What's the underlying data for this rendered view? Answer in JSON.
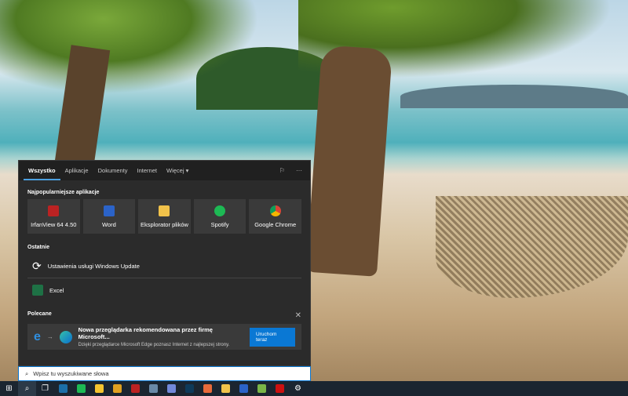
{
  "tabs": [
    "Wszystko",
    "Aplikacje",
    "Dokumenty",
    "Internet",
    "Więcej"
  ],
  "sections": {
    "top": "Najpopularniejsze aplikacje",
    "recent": "Ostatnie",
    "recommended": "Polecane"
  },
  "top_apps": [
    {
      "label": "IrfanView 64 4.50",
      "color": "#b22"
    },
    {
      "label": "Word",
      "color": "#2b63c8"
    },
    {
      "label": "Eksplorator plików",
      "color": "#f1c24a"
    },
    {
      "label": "Spotify",
      "color": "#1db954"
    },
    {
      "label": "Google Chrome",
      "color": "#e0a020"
    }
  ],
  "recent": [
    {
      "label": "Ustawienia usługi Windows Update"
    },
    {
      "label": "Excel"
    }
  ],
  "recommended": {
    "title": "Nowa przeglądarka rekomendowana przez firmę Microsoft...",
    "subtitle": "Dzięki przeglądarce Microsoft Edge poznasz Internet z najlepszej strony.",
    "button": "Uruchom teraz"
  },
  "search": {
    "placeholder": "Wpisz tu wyszukiwane słowa"
  },
  "taskbar": [
    {
      "name": "steam",
      "color": "#1b6fa8"
    },
    {
      "name": "spotify",
      "color": "#1db954"
    },
    {
      "name": "sticky-notes",
      "color": "#f4c430"
    },
    {
      "name": "chrome",
      "color": "#e0a020"
    },
    {
      "name": "irfanview",
      "color": "#b22"
    },
    {
      "name": "calculator",
      "color": "#6a8aa8"
    },
    {
      "name": "discord",
      "color": "#7289da"
    },
    {
      "name": "photoshop",
      "color": "#0e3a5a"
    },
    {
      "name": "firefox",
      "color": "#e86a3a"
    },
    {
      "name": "file-explorer",
      "color": "#f1c24a"
    },
    {
      "name": "word",
      "color": "#2b63c8"
    },
    {
      "name": "image-editor",
      "color": "#7ab648"
    },
    {
      "name": "netflix",
      "color": "#c11"
    }
  ]
}
